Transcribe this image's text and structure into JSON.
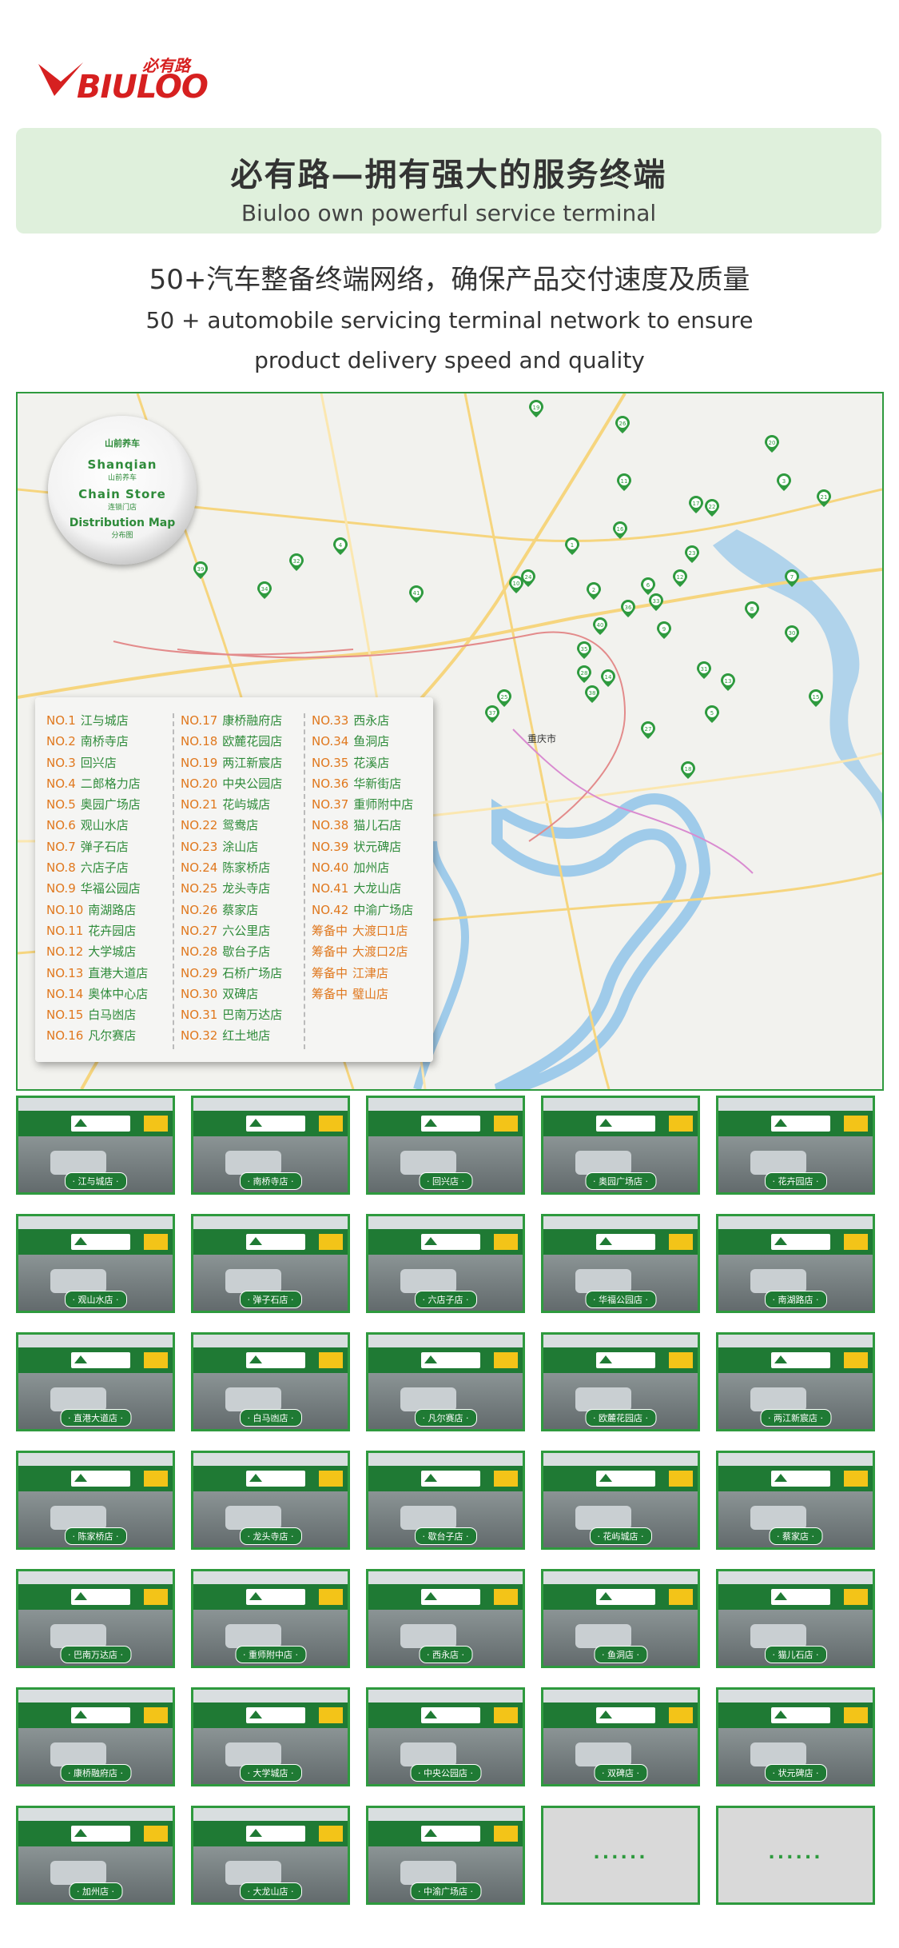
{
  "brand": {
    "cn": "必有路",
    "en": "BIULOO"
  },
  "banner": {
    "title": "必有路—拥有强大的服务终端",
    "subtitle": "Biuloo own powerful service terminal"
  },
  "intro": {
    "cn": "50+汽车整备终端网络，确保产品交付速度及质量",
    "en_line1": "50 + automobile servicing terminal network to ensure",
    "en_line2": "product delivery speed and quality"
  },
  "map": {
    "badge": {
      "logo": "山前养车",
      "line1": "Shanqian",
      "line1_cn": "山前养车",
      "line2": "Chain Store",
      "line2_cn": "连锁门店",
      "line3": "Distribution Map",
      "line3_cn": "分布图"
    },
    "station_label": "重庆市",
    "legend_col1": [
      {
        "no": "NO.1",
        "name": "江与城店"
      },
      {
        "no": "NO.2",
        "name": "南桥寺店"
      },
      {
        "no": "NO.3",
        "name": "回兴店"
      },
      {
        "no": "NO.4",
        "name": "二郎格力店"
      },
      {
        "no": "NO.5",
        "name": "奥园广场店"
      },
      {
        "no": "NO.6",
        "name": "观山水店"
      },
      {
        "no": "NO.7",
        "name": "弹子石店"
      },
      {
        "no": "NO.8",
        "name": "六店子店"
      },
      {
        "no": "NO.9",
        "name": "华福公园店"
      },
      {
        "no": "NO.10",
        "name": "南湖路店"
      },
      {
        "no": "NO.11",
        "name": "花卉园店"
      },
      {
        "no": "NO.12",
        "name": "大学城店"
      },
      {
        "no": "NO.13",
        "name": "直港大道店"
      },
      {
        "no": "NO.14",
        "name": "奥体中心店"
      },
      {
        "no": "NO.15",
        "name": "白马凼店"
      },
      {
        "no": "NO.16",
        "name": "凡尔赛店"
      }
    ],
    "legend_col2": [
      {
        "no": "NO.17",
        "name": "康桥融府店"
      },
      {
        "no": "NO.18",
        "name": "欧麓花园店"
      },
      {
        "no": "NO.19",
        "name": "两江新宸店"
      },
      {
        "no": "NO.20",
        "name": "中央公园店"
      },
      {
        "no": "NO.21",
        "name": "花屿城店"
      },
      {
        "no": "NO.22",
        "name": "鸳鸯店"
      },
      {
        "no": "NO.23",
        "name": "涂山店"
      },
      {
        "no": "NO.24",
        "name": "陈家桥店"
      },
      {
        "no": "NO.25",
        "name": "龙头寺店"
      },
      {
        "no": "NO.26",
        "name": "蔡家店"
      },
      {
        "no": "NO.27",
        "name": "六公里店"
      },
      {
        "no": "NO.28",
        "name": "歇台子店"
      },
      {
        "no": "NO.29",
        "name": "石桥广场店"
      },
      {
        "no": "NO.30",
        "name": "双碑店"
      },
      {
        "no": "NO.31",
        "name": "巴南万达店"
      },
      {
        "no": "NO.32",
        "name": "红土地店"
      }
    ],
    "legend_col3": [
      {
        "no": "NO.33",
        "name": "西永店"
      },
      {
        "no": "NO.34",
        "name": "鱼洞店"
      },
      {
        "no": "NO.35",
        "name": "花溪店"
      },
      {
        "no": "NO.36",
        "name": "华新街店"
      },
      {
        "no": "NO.37",
        "name": "重师附中店"
      },
      {
        "no": "NO.38",
        "name": "猫儿石店"
      },
      {
        "no": "NO.39",
        "name": "状元碑店"
      },
      {
        "no": "NO.40",
        "name": "加州店"
      },
      {
        "no": "NO.41",
        "name": "大龙山店"
      },
      {
        "no": "NO.42",
        "name": "中渝广场店"
      },
      {
        "no": "筹备中",
        "name": "大渡口1店"
      },
      {
        "no": "筹备中",
        "name": "大渡口2店"
      },
      {
        "no": "筹备中",
        "name": "江津店"
      },
      {
        "no": "筹备中",
        "name": "璧山店"
      }
    ],
    "pins": [
      "19",
      "26",
      "20",
      "3",
      "21",
      "17",
      "22",
      "11",
      "16",
      "1",
      "23",
      "7",
      "2",
      "8",
      "24",
      "6",
      "33",
      "12",
      "36",
      "9",
      "40",
      "10",
      "30",
      "35",
      "28",
      "14",
      "31",
      "13",
      "25",
      "38",
      "37",
      "27",
      "15",
      "5",
      "18",
      "4",
      "32",
      "34",
      "39",
      "41"
    ]
  },
  "stores": [
    "江与城店",
    "南桥寺店",
    "回兴店",
    "奥园广场店",
    "花卉园店",
    "观山水店",
    "弹子石店",
    "六店子店",
    "华福公园店",
    "南湖路店",
    "直港大道店",
    "白马凼店",
    "凡尔赛店",
    "欧麓花园店",
    "两江新宸店",
    "陈家桥店",
    "龙头寺店",
    "歇台子店",
    "花屿城店",
    "蔡家店",
    "巴南万达店",
    "重师附中店",
    "西永店",
    "鱼洞店",
    "猫儿石店",
    "康桥融府店",
    "大学城店",
    "中央公园店",
    "双碑店",
    "状元碑店",
    "加州店",
    "大龙山店",
    "中渝广场店"
  ],
  "more_label": "......",
  "colors": {
    "green": "#2e9a3e",
    "orange": "#e0781e",
    "red": "#d62020",
    "banner_bg": "#dff0dc"
  }
}
